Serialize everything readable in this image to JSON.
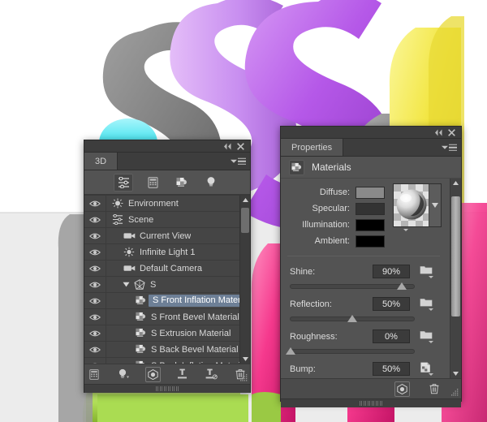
{
  "artwork": {
    "description": "glossy-3d-letters-render",
    "colors": {
      "purple": "#b558e8",
      "purple_light": "#c88ef0",
      "gray": "#8a8a8a",
      "gray_dark": "#6f6f6f",
      "cyan": "#43e3ee",
      "yellow": "#f2e53f",
      "pink": "#f5398d",
      "green": "#b3e05a",
      "background": "#ffffff",
      "floor": "#ececec"
    }
  },
  "panel3d": {
    "tab_label": "3D",
    "collapse_icon": "collapse-double-arrow-icon",
    "close_icon": "close-icon",
    "menu_icon": "panel-menu-icon",
    "toolbar": [
      {
        "name": "scene-filter-icon",
        "label": "Scene",
        "active": true
      },
      {
        "name": "mesh-filter-icon",
        "label": "Meshes",
        "active": false
      },
      {
        "name": "materials-filter-icon",
        "label": "Materials",
        "active": false
      },
      {
        "name": "lights-filter-icon",
        "label": "Lights",
        "active": false
      }
    ],
    "rows": [
      {
        "label": "Environment",
        "icon": "environment-icon",
        "indent": 0,
        "selected": false,
        "disclosure": ""
      },
      {
        "label": "Scene",
        "icon": "scene-icon",
        "indent": 0,
        "selected": false,
        "disclosure": ""
      },
      {
        "label": "Current View",
        "icon": "camera-icon",
        "indent": 1,
        "selected": false,
        "disclosure": ""
      },
      {
        "label": "Infinite Light 1",
        "icon": "light-icon",
        "indent": 1,
        "selected": false,
        "disclosure": ""
      },
      {
        "label": "Default Camera",
        "icon": "camera-icon",
        "indent": 1,
        "selected": false,
        "disclosure": ""
      },
      {
        "label": "S",
        "icon": "mesh-icon",
        "indent": 1,
        "selected": false,
        "disclosure": "expanded"
      },
      {
        "label": "S Front Inflation Material",
        "icon": "material-icon",
        "indent": 2,
        "selected": true,
        "disclosure": ""
      },
      {
        "label": "S Front Bevel Material",
        "icon": "material-icon",
        "indent": 2,
        "selected": false,
        "disclosure": ""
      },
      {
        "label": "S Extrusion Material",
        "icon": "material-icon",
        "indent": 2,
        "selected": false,
        "disclosure": ""
      },
      {
        "label": "S Back Bevel Material",
        "icon": "material-icon",
        "indent": 2,
        "selected": false,
        "disclosure": ""
      },
      {
        "label": "S Back Inflation Material",
        "icon": "material-icon",
        "indent": 2,
        "selected": false,
        "disclosure": ""
      }
    ],
    "scroll": {
      "thumb_top_pct": 2,
      "thumb_height_pct": 17
    },
    "bottom_buttons": [
      {
        "name": "add-mesh-icon",
        "boxed": false
      },
      {
        "name": "add-light-icon",
        "boxed": false
      },
      {
        "name": "render-icon",
        "boxed": true
      },
      {
        "name": "ground-plane-shadow-catcher-icon",
        "boxed": false
      },
      {
        "name": "remove-ground-plane-icon",
        "boxed": false
      },
      {
        "name": "delete-icon",
        "boxed": false
      }
    ],
    "selection_highlight_color": "#6d7f96"
  },
  "properties": {
    "tab_label": "Properties",
    "collapse_icon": "collapse-double-arrow-icon",
    "close_icon": "close-icon",
    "menu_icon": "panel-menu-icon",
    "section_title": "Materials",
    "section_icon": "material-icon",
    "colors": [
      {
        "label": "Diffuse:",
        "swatch": "#8a8a8a",
        "picker": "texture-menu-icon"
      },
      {
        "label": "Specular:",
        "swatch": "#333333",
        "picker": "folder-icon"
      },
      {
        "label": "Illumination:",
        "swatch": "#000000",
        "picker": "folder-icon"
      },
      {
        "label": "Ambient:",
        "swatch": "#000000",
        "picker": ""
      }
    ],
    "preview": {
      "name": "material-sphere-preview",
      "dropdown_icon": "chevron-down-icon"
    },
    "sliders": [
      {
        "label": "Shine:",
        "value": "90%",
        "percent": 90,
        "picker": "folder-icon"
      },
      {
        "label": "Reflection:",
        "value": "50%",
        "percent": 50,
        "picker": "folder-icon"
      },
      {
        "label": "Roughness:",
        "value": "0%",
        "percent": 0,
        "picker": "folder-icon"
      },
      {
        "label": "Bump:",
        "value": "50%",
        "percent": 50,
        "picker": "texture-menu-icon"
      }
    ],
    "scroll": {
      "thumb_top_pct": 5,
      "thumb_height_pct": 66
    },
    "bottom_buttons": [
      {
        "name": "render-icon",
        "boxed": true
      },
      {
        "name": "delete-icon",
        "boxed": false
      }
    ]
  }
}
